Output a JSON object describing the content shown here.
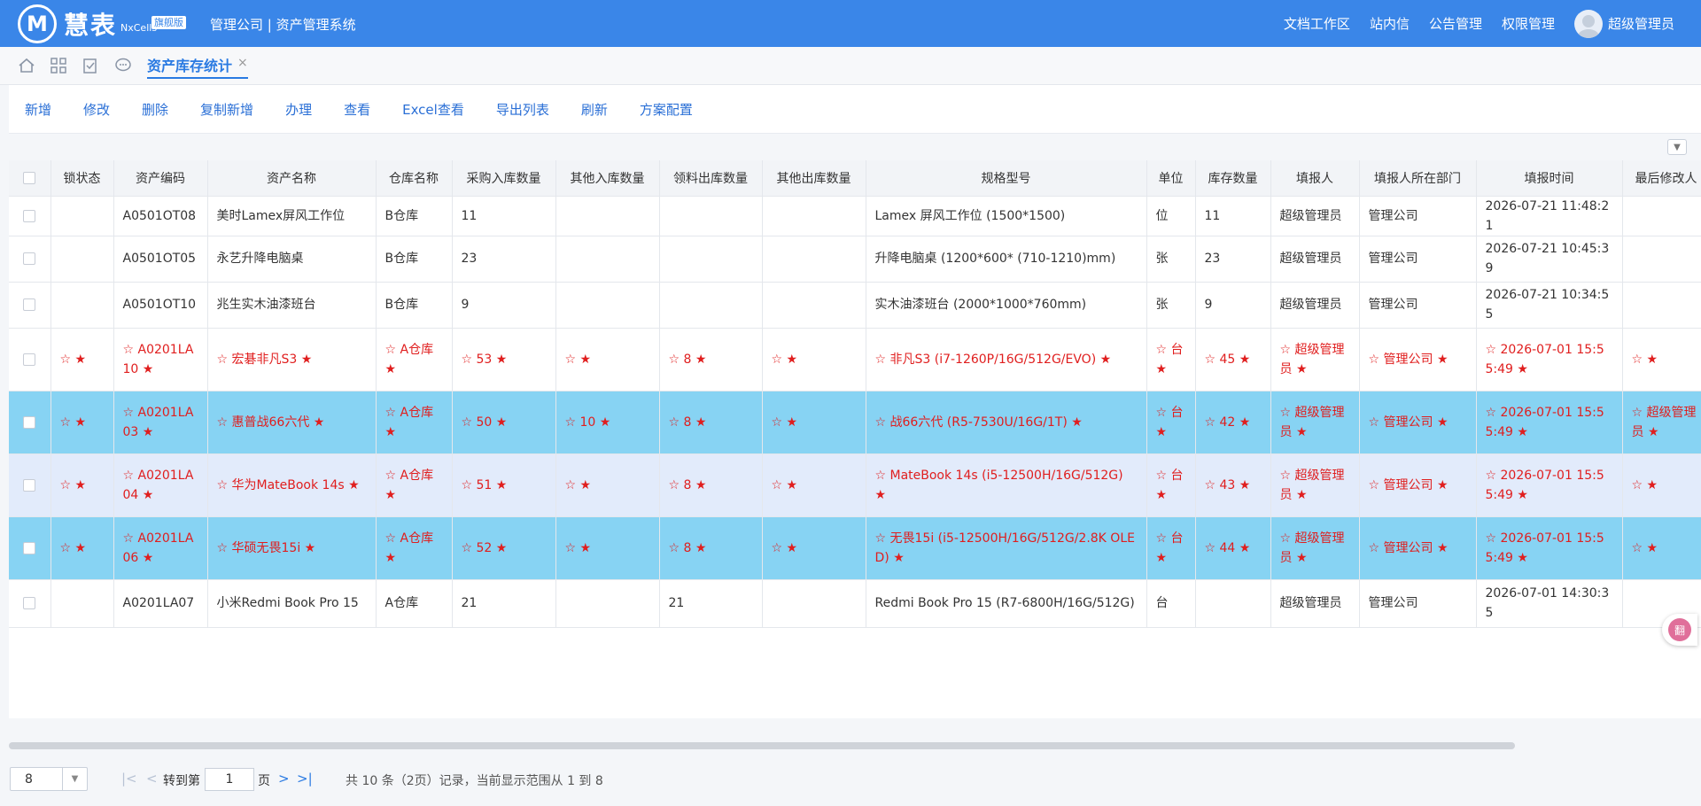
{
  "header": {
    "logo_glyph": "M",
    "logo_text": "慧表",
    "brand": "NxCells",
    "badge": "旗舰版",
    "system_title": "管理公司 | 资产管理系统",
    "menu": [
      "文档工作区",
      "站内信",
      "公告管理",
      "权限管理"
    ],
    "user": "超级管理员"
  },
  "tabs": {
    "icons": [
      "home-icon",
      "apps-icon",
      "task-check-icon",
      "chat-icon"
    ],
    "active_label": "资产库存统计",
    "close": "×"
  },
  "toolbar": [
    "新增",
    "修改",
    "删除",
    "复制新增",
    "办理",
    "查看",
    "Excel查看",
    "导出列表",
    "刷新",
    "方案配置"
  ],
  "table": {
    "columns": [
      "",
      "锁状态",
      "资产编码",
      "资产名称",
      "仓库名称",
      "采购入库数量",
      "其他入库数量",
      "领料出库数量",
      "其他出库数量",
      "规格型号",
      "单位",
      "库存数量",
      "填报人",
      "填报人所在部门",
      "填报时间",
      "最后修改人"
    ],
    "rows": [
      {
        "style": "normal",
        "cells": [
          "",
          "",
          "A0501OT08",
          "美时Lamex屏风工作位",
          "B仓库",
          "11",
          "",
          "",
          "",
          "Lamex 屏风工作位 (1500*1500)",
          "位",
          "11",
          "超级管理员",
          "管理公司",
          "2026-07-21 11:48:21",
          ""
        ]
      },
      {
        "style": "normal",
        "cells": [
          "",
          "",
          "A0501OT05",
          "永艺升降电脑桌",
          "B仓库",
          "23",
          "",
          "",
          "",
          "升降电脑桌 (1200*600* (710-1210)mm)",
          "张",
          "23",
          "超级管理员",
          "管理公司",
          "2026-07-21 10:45:39",
          ""
        ]
      },
      {
        "style": "normal",
        "cells": [
          "",
          "",
          "A0501OT10",
          "兆生实木油漆班台",
          "B仓库",
          "9",
          "",
          "",
          "",
          "实木油漆班台 (2000*1000*760mm)",
          "张",
          "9",
          "超级管理员",
          "管理公司",
          "2026-07-21 10:34:55",
          ""
        ]
      },
      {
        "style": "red",
        "cells": [
          "",
          "☆ ★",
          "☆ A0201LA10 ★",
          "☆ 宏碁非凡S3 ★",
          "☆ A仓库 ★",
          "☆ 53 ★",
          "☆ ★",
          "☆ 8 ★",
          "☆ ★",
          "☆ 非凡S3 (i7-1260P/16G/512G/EVO) ★",
          "☆ 台 ★",
          "☆ 45 ★",
          "☆ 超级管理员 ★",
          "☆ 管理公司 ★",
          "☆ 2026-07-01 15:55:49 ★",
          "☆ ★"
        ]
      },
      {
        "style": "red sel",
        "cells": [
          "",
          "☆ ★",
          "☆ A0201LA03 ★",
          "☆ 惠普战66六代 ★",
          "☆ A仓库 ★",
          "☆ 50 ★",
          "☆ 10 ★",
          "☆ 8 ★",
          "☆ ★",
          "☆ 战66六代 (R5-7530U/16G/1T) ★",
          "☆ 台 ★",
          "☆ 42 ★",
          "☆ 超级管理员 ★",
          "☆ 管理公司 ★",
          "☆ 2026-07-01 15:55:49 ★",
          "☆ 超级管理员 ★"
        ]
      },
      {
        "style": "red hov",
        "cells": [
          "",
          "☆ ★",
          "☆ A0201LA04 ★",
          "☆ 华为MateBook 14s ★",
          "☆ A仓库 ★",
          "☆ 51 ★",
          "☆ ★",
          "☆ 8 ★",
          "☆ ★",
          "☆ MateBook 14s (i5-12500H/16G/512G) ★",
          "☆ 台 ★",
          "☆ 43 ★",
          "☆ 超级管理员 ★",
          "☆ 管理公司 ★",
          "☆ 2026-07-01 15:55:49 ★",
          "☆ ★"
        ]
      },
      {
        "style": "red sel",
        "cells": [
          "",
          "☆ ★",
          "☆ A0201LA06 ★",
          "☆ 华硕无畏15i ★",
          "☆ A仓库 ★",
          "☆ 52 ★",
          "☆ ★",
          "☆ 8 ★",
          "☆ ★",
          "☆ 无畏15i (i5-12500H/16G/512G/2.8K OLED) ★",
          "☆ 台 ★",
          "☆ 44 ★",
          "☆ 超级管理员 ★",
          "☆ 管理公司 ★",
          "☆ 2026-07-01 15:55:49 ★",
          "☆ ★"
        ]
      },
      {
        "style": "normal",
        "cells": [
          "",
          "",
          "A0201LA07",
          "小米Redmi Book Pro 15",
          "A仓库",
          "21",
          "",
          "21",
          "",
          "Redmi Book Pro 15 (R7-6800H/16G/512G)",
          "台",
          "",
          "超级管理员",
          "管理公司",
          "2026-07-01 14:30:35",
          ""
        ]
      }
    ]
  },
  "pager": {
    "page_size": "8",
    "goto_label": "转到第",
    "page_value": "1",
    "page_unit": "页",
    "info": "共 10 条（2页）记录，当前显示范围从 1 到 8"
  },
  "float_button": "翻"
}
